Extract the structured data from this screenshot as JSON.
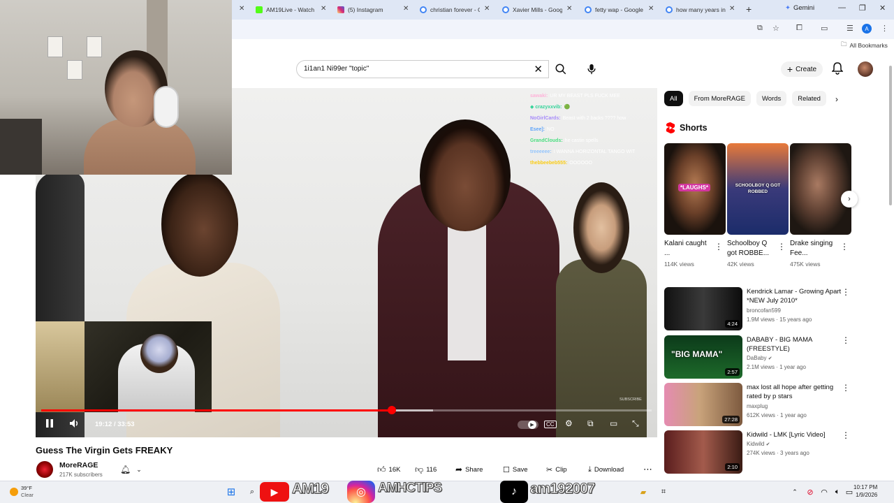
{
  "browser": {
    "tabs": [
      {
        "label": "AM19Live - Watch",
        "color": "#53fc18"
      },
      {
        "label": "(5) Instagram",
        "color": "#d6249f"
      },
      {
        "label": "christian forever - G",
        "color": "#4285f4"
      },
      {
        "label": "Xavier Mills - Goog",
        "color": "#4285f4"
      },
      {
        "label": "fetty wap - Google",
        "color": "#4285f4"
      },
      {
        "label": "how many years in",
        "color": "#4285f4"
      }
    ],
    "gemini_label": "Gemini",
    "bookmarks_label": "All Bookmarks"
  },
  "header": {
    "search_query": "1i1an1 Ni99er \"topic\"",
    "create_label": "Create"
  },
  "player": {
    "time_current": "19:12",
    "time_total": "33:53",
    "progress": 0.574,
    "buffered": 0.642,
    "subscribe_watermark": "SUBSCRIBE",
    "chat": [
      {
        "user": "sawaki:",
        "msg": "UR MY BEAST PLS FUCK MEE",
        "color": "#ffb3d9"
      },
      {
        "user": "◆ crazyxxvib:",
        "msg": "🟢",
        "color": "#34d399"
      },
      {
        "user": "NoGirlCards:",
        "msg": "Beast with 2 backs ???? how",
        "color": "#a78bfa"
      },
      {
        "user": "Esee]:",
        "msg": "NO",
        "color": "#60a5fa"
      },
      {
        "user": "GrandClouds:",
        "msg": "he castin spells",
        "color": "#4ade80"
      },
      {
        "user": "treeeeee:",
        "msg": "I WANNA HORIZONTAL TANGO WIT",
        "color": "#93c5fd"
      },
      {
        "user": "thebbeebeb555:",
        "msg": "OOOOOO",
        "color": "#facc15"
      }
    ]
  },
  "video": {
    "title": "Guess The Virgin Gets FREAKY",
    "channel": "MoreRAGE",
    "subscribers": "217K subscribers",
    "likes": "16K",
    "dislikes": "116",
    "share": "Share",
    "save": "Save",
    "clip": "Clip",
    "download": "Download"
  },
  "sidebar": {
    "chips": [
      "All",
      "From MoreRAGE",
      "Words",
      "Related"
    ],
    "shorts_heading": "Shorts",
    "shorts": [
      {
        "title": "Kalani caught ...",
        "views": "114K views",
        "caption": "*LAUGHS*"
      },
      {
        "title": "Schoolboy Q got ROBBE...",
        "views": "42K views",
        "caption": "SCHOOLBOY Q GOT ROBBED"
      },
      {
        "title": "Drake singing Fee...",
        "views": "475K views",
        "caption": ""
      }
    ],
    "videos": [
      {
        "title": "Kendrick Lamar - Growing Apart *NEW July 2010*",
        "channel": "broncofan599",
        "meta": "1.9M views · 15 years ago",
        "duration": "4:24",
        "verified": false
      },
      {
        "title": "DABABY - BIG MAMA (FREESTYLE)",
        "channel": "DaBaby",
        "meta": "2.1M views · 1 year ago",
        "duration": "2:57",
        "verified": true,
        "thumb_text": "\"BIG MAMA\""
      },
      {
        "title": "max lost all hope after getting rated by p stars",
        "channel": "maxplug",
        "meta": "612K views · 1 year ago",
        "duration": "27:28",
        "verified": false
      },
      {
        "title": "Kidwild - LMK [Lyric Video]",
        "channel": "Kidwild",
        "meta": "274K views · 3 years ago",
        "duration": "2:10",
        "verified": true
      }
    ]
  },
  "taskbar": {
    "temp": "39°F",
    "weather": "Clear",
    "time": "10:17 PM",
    "date": "1/9/2026",
    "overlay_left": "AM19",
    "overlay_mid": "AMHCTIPS",
    "overlay_right": "am192007"
  },
  "colors": {
    "accent": "#ff0000",
    "chip_active": "#0f0f0f"
  }
}
